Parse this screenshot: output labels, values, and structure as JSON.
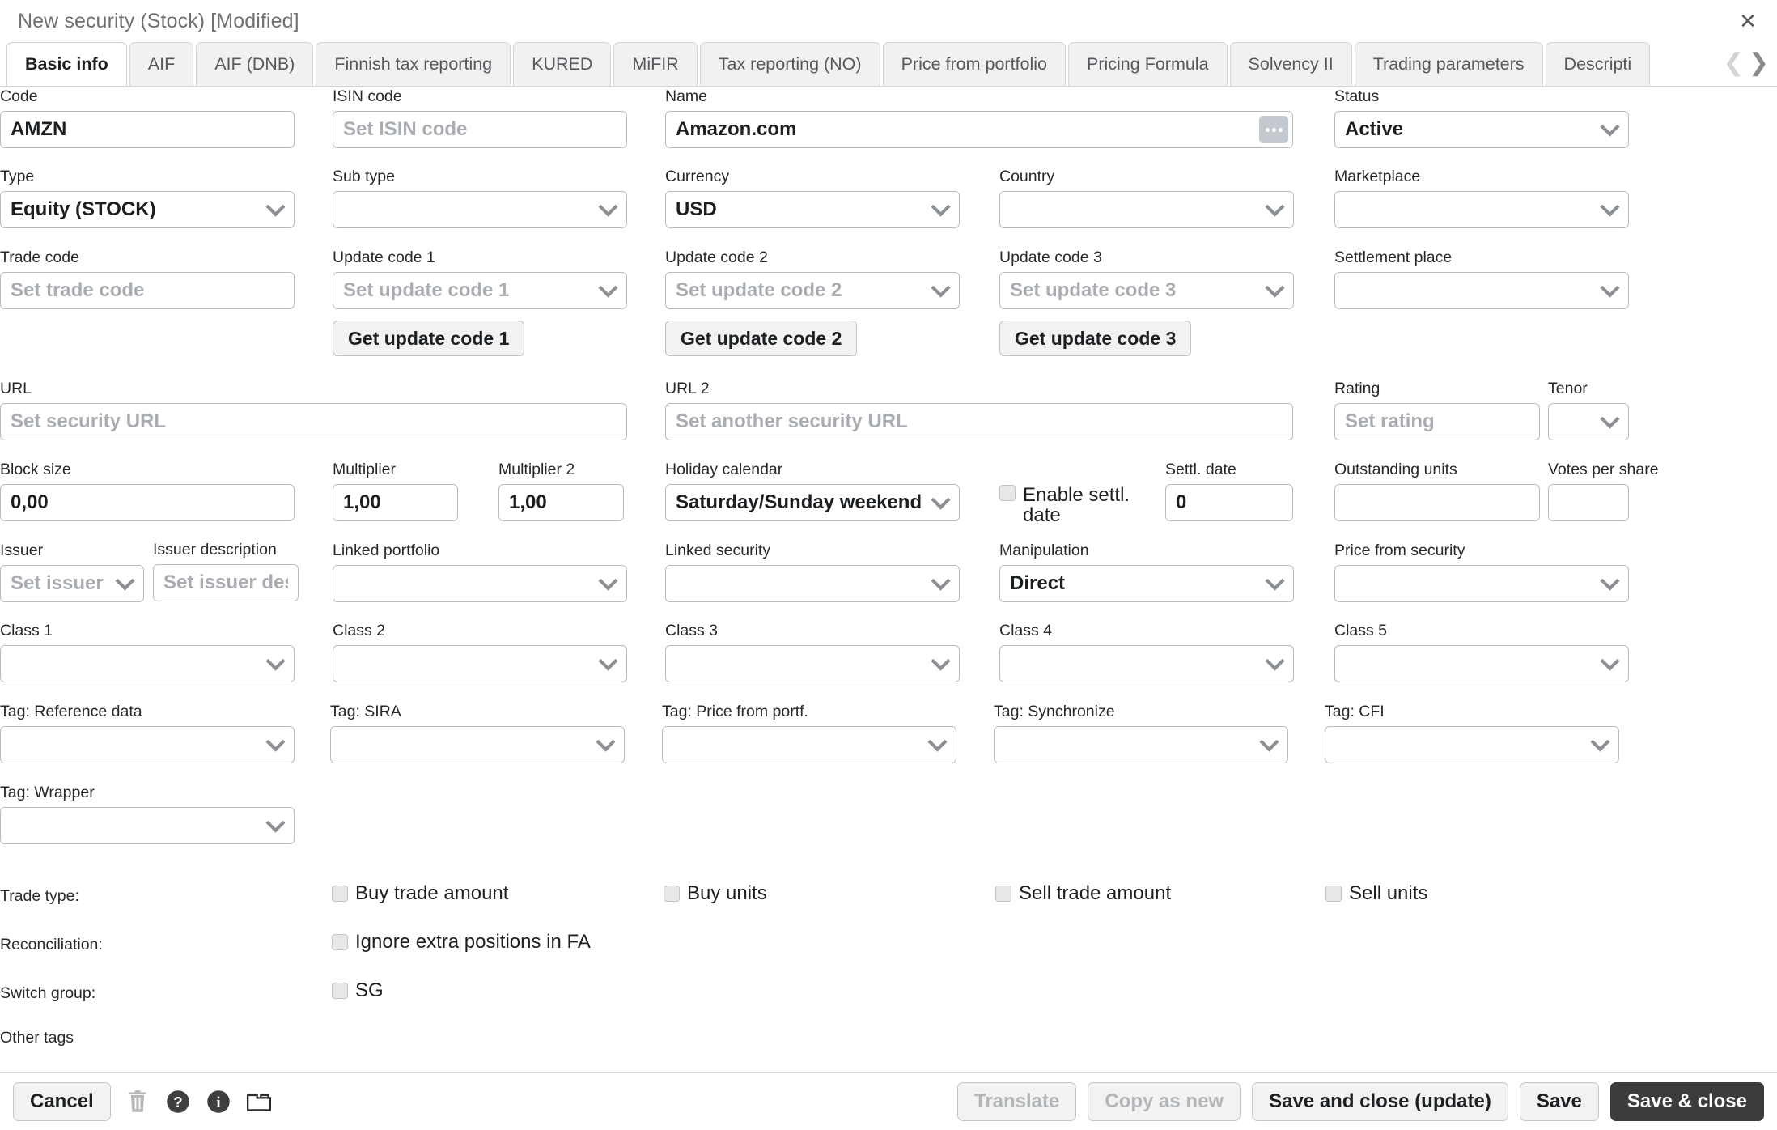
{
  "window": {
    "title": "New security (Stock) [Modified]",
    "close_icon": "close-icon"
  },
  "tabs": {
    "items": [
      {
        "label": "Basic info",
        "active": true
      },
      {
        "label": "AIF",
        "active": false
      },
      {
        "label": "AIF (DNB)",
        "active": false
      },
      {
        "label": "Finnish tax reporting",
        "active": false
      },
      {
        "label": "KURED",
        "active": false
      },
      {
        "label": "MiFIR",
        "active": false
      },
      {
        "label": "Tax reporting (NO)",
        "active": false
      },
      {
        "label": "Price from portfolio",
        "active": false
      },
      {
        "label": "Pricing Formula",
        "active": false
      },
      {
        "label": "Solvency II",
        "active": false
      },
      {
        "label": "Trading parameters",
        "active": false
      },
      {
        "label": "Descripti",
        "active": false
      }
    ],
    "scroll_prev_icon": "chevron-left-icon",
    "scroll_next_icon": "chevron-right-icon"
  },
  "form": {
    "code": {
      "label": "Code",
      "value": "AMZN",
      "placeholder": ""
    },
    "isin_code": {
      "label": "ISIN code",
      "value": "",
      "placeholder": "Set ISIN code"
    },
    "name": {
      "label": "Name",
      "value": "Amazon.com",
      "placeholder": "",
      "button_icon": "ellipsis-icon"
    },
    "status": {
      "label": "Status",
      "value": "Active"
    },
    "type": {
      "label": "Type",
      "value": "Equity (STOCK)"
    },
    "sub_type": {
      "label": "Sub type",
      "value": ""
    },
    "currency": {
      "label": "Currency",
      "value": "USD"
    },
    "country": {
      "label": "Country",
      "value": ""
    },
    "marketplace": {
      "label": "Marketplace",
      "value": ""
    },
    "trade_code": {
      "label": "Trade code",
      "value": "",
      "placeholder": "Set trade code"
    },
    "update_code_1": {
      "label": "Update code 1",
      "value": "",
      "placeholder": "Set update code 1",
      "button": "Get update code 1"
    },
    "update_code_2": {
      "label": "Update code 2",
      "value": "",
      "placeholder": "Set update code 2",
      "button": "Get update code 2"
    },
    "update_code_3": {
      "label": "Update code 3",
      "value": "",
      "placeholder": "Set update code 3",
      "button": "Get update code 3"
    },
    "settlement_place": {
      "label": "Settlement place",
      "value": ""
    },
    "url": {
      "label": "URL",
      "value": "",
      "placeholder": "Set security URL"
    },
    "url2": {
      "label": "URL 2",
      "value": "",
      "placeholder": "Set another security URL"
    },
    "rating": {
      "label": "Rating",
      "value": "",
      "placeholder": "Set rating"
    },
    "tenor": {
      "label": "Tenor",
      "value": ""
    },
    "block_size": {
      "label": "Block size",
      "value": "0,00"
    },
    "multiplier": {
      "label": "Multiplier",
      "value": "1,00"
    },
    "multiplier2": {
      "label": "Multiplier 2",
      "value": "1,00"
    },
    "holiday_calendar": {
      "label": "Holiday calendar",
      "value": "Saturday/Sunday weekend"
    },
    "enable_settl_date": {
      "label": "Enable settl. date",
      "checked": false
    },
    "settl_date": {
      "label": "Settl. date",
      "value": "0"
    },
    "outstanding_units": {
      "label": "Outstanding units",
      "value": ""
    },
    "votes_per_share": {
      "label": "Votes per share",
      "value": ""
    },
    "issuer": {
      "label": "Issuer",
      "value": "",
      "placeholder": "Set issuer"
    },
    "issuer_description": {
      "label": "Issuer description",
      "value": "",
      "placeholder": "Set issuer desc"
    },
    "linked_portfolio": {
      "label": "Linked portfolio",
      "value": ""
    },
    "linked_security": {
      "label": "Linked security",
      "value": ""
    },
    "manipulation": {
      "label": "Manipulation",
      "value": "Direct"
    },
    "price_from_security": {
      "label": "Price from security",
      "value": ""
    },
    "class1": {
      "label": "Class 1",
      "value": ""
    },
    "class2": {
      "label": "Class 2",
      "value": ""
    },
    "class3": {
      "label": "Class 3",
      "value": ""
    },
    "class4": {
      "label": "Class 4",
      "value": ""
    },
    "class5": {
      "label": "Class 5",
      "value": ""
    },
    "tag_reference_data": {
      "label": "Tag: Reference data",
      "value": ""
    },
    "tag_sira": {
      "label": "Tag: SIRA",
      "value": ""
    },
    "tag_price_from_portf": {
      "label": "Tag: Price from portf.",
      "value": ""
    },
    "tag_synchronize": {
      "label": "Tag: Synchronize",
      "value": ""
    },
    "tag_cfi": {
      "label": "Tag: CFI",
      "value": ""
    },
    "tag_wrapper": {
      "label": "Tag: Wrapper",
      "value": ""
    },
    "trade_type": {
      "label": "Trade type:",
      "options": [
        {
          "label": "Buy trade amount",
          "checked": false
        },
        {
          "label": "Buy units",
          "checked": false
        },
        {
          "label": "Sell trade amount",
          "checked": false
        },
        {
          "label": "Sell units",
          "checked": false
        }
      ]
    },
    "reconciliation": {
      "label": "Reconciliation:",
      "options": [
        {
          "label": "Ignore extra positions in FA",
          "checked": false
        }
      ]
    },
    "switch_group": {
      "label": "Switch group:",
      "options": [
        {
          "label": "SG",
          "checked": false
        }
      ]
    },
    "other_tags": {
      "label": "Other tags"
    }
  },
  "footer": {
    "cancel": "Cancel",
    "delete_icon": "trash-icon",
    "help_icon": "question-circle-icon",
    "info_icon": "info-circle-icon",
    "folder_icon": "folder-icon",
    "translate": "Translate",
    "copy_as_new": "Copy as new",
    "save_and_close_update": "Save and close (update)",
    "save": "Save",
    "save_and_close": "Save & close"
  },
  "colors": {
    "primary_button": "#3c3c3c",
    "border": "#b9bcbf",
    "label_text": "#26292c",
    "placeholder": "#a9adb1"
  }
}
